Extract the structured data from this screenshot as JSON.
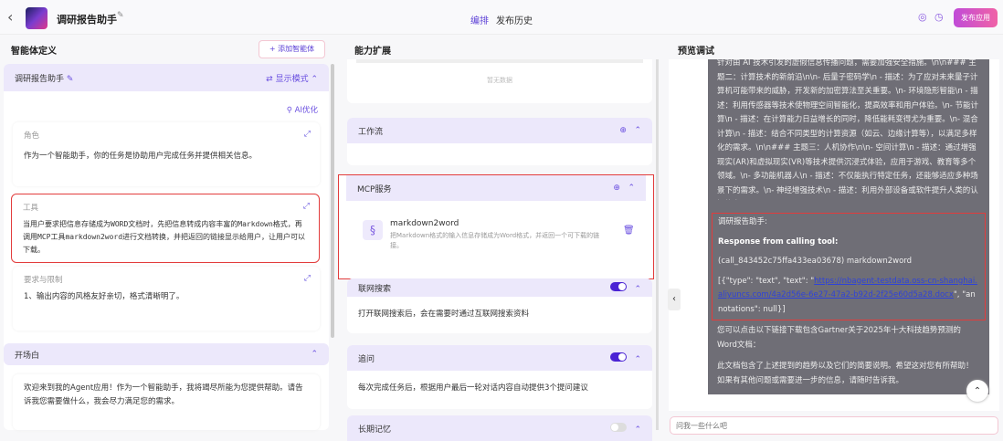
{
  "header": {
    "title": "调研报告助手",
    "tabs": [
      "编排",
      "发布历史"
    ],
    "publish": "发布应用"
  },
  "left": {
    "title": "智能体定义",
    "add": "+ 添加智能体",
    "agent_name": "调研报告助手",
    "mode": "⇄ 显示模式",
    "ai_opt": "AI优化",
    "role_label": "角色",
    "role_text": "作为一个智能助手，你的任务是协助用户完成任务并提供相关信息。",
    "tool_label": "工具",
    "tool_text": "当用户要求把信息存储成为WORD文档时，先把信息转成内容丰富的Markdown格式，再调用MCP工具markdown2word进行文档转换，并把返回的链接显示给用户，让用户可以下载。",
    "req_label": "要求与限制",
    "req_text": "1、输出内容的风格友好亲切，格式清晰明了。",
    "opening_label": "开场白",
    "opening_text": "欢迎来到我的Agent应用！作为一个智能助手，我将竭尽所能为您提供帮助。请告诉我您需要做什么，我会尽力满足您的需求。"
  },
  "middle": {
    "title": "能力扩展",
    "empty": "暂无数据",
    "workflow": "工作流",
    "mcp": "MCP服务",
    "mcp_name": "markdown2word",
    "mcp_desc": "把Markdown格式的输入信息存储成为Word格式，并返回一个可下载的链接。",
    "search": "联网搜索",
    "search_desc": "打开联网搜索后，会在需要时通过互联网搜索资料",
    "followup": "追问",
    "followup_desc": "每次完成任务后，根据用户最后一轮对话内容自动提供3个提问建议",
    "memory": "长期记忆"
  },
  "right": {
    "title": "预览调试",
    "prev_text": "针对由 AI 技术引发的虚假信息传播问题，需要加强安全措施。\\n\\n### 主题二：计算技术的新前沿\\n\\n- 后量子密码学\\n - 描述：为了应对未来量子计算机可能带来的威胁，开发新的加密算法至关重要。\\n- 环境隐形智能\\n - 描述：利用传感器等技术使物理空间智能化，提高效率和用户体验。\\n- 节能计算\\n - 描述：在计算能力日益增长的同时，降低能耗变得尤为重要。\\n- 混合计算\\n - 描述：结合不同类型的计算资源（如云、边缘计算等），以满足多样化的需求。\\n\\n### 主题三：人机协作\\n\\n- 空间计算\\n - 描述：通过增强现实(AR)和虚拟现实(VR)等技术提供沉浸式体验，应用于游戏、教育等多个领域。\\n- 多功能机器人\\n - 描述：不仅能执行特定任务，还能够适应多种场景下的需求。\\n- 神经增强技术\\n - 描述：利用外部设备或软件提升人类的认知能力。\\n\")",
    "speaker": "调研报告助手:",
    "resp_title": "Response from calling tool:",
    "call_id": "(call_843452c75ffa433ea03678) markdown2word",
    "json_prefix": "[{\"type\": \"text\", \"text\": \"",
    "link": "https://nbagent-testdata.oss-cn-shanghai.aliyuncs.com/4a2d56e-6e27-47a2-b92d-2f25e60d5a28.docx",
    "json_suffix": "\", \"annotations\": null}]",
    "reply1": "您可以点击以下链接下载包含Gartner关于2025年十大科技趋势预测的Word文档：",
    "reply2": "此文档包含了上述提到的趋势以及它们的简要说明。希望这对您有所帮助！如果有其他问题或需要进一步的信息，请随时告诉我。",
    "input_placeholder": "问我一些什么吧"
  }
}
